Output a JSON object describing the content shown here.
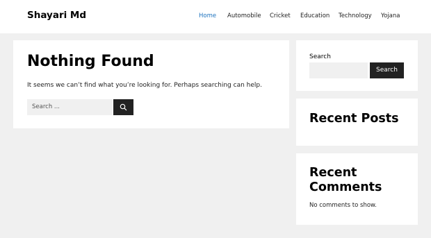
{
  "site": {
    "title": "Shayari Md"
  },
  "nav": {
    "items": [
      {
        "label": "Home",
        "active": true
      },
      {
        "label": "Automobile",
        "active": false
      },
      {
        "label": "Cricket",
        "active": false
      },
      {
        "label": "Education",
        "active": false
      },
      {
        "label": "Technology",
        "active": false
      },
      {
        "label": "Yojana",
        "active": false
      }
    ]
  },
  "main": {
    "title": "Nothing Found",
    "message": "It seems we can’t find what you’re looking for. Perhaps searching can help.",
    "search": {
      "placeholder": "Search ...",
      "button_icon": "search-icon"
    }
  },
  "sidebar": {
    "search_widget": {
      "label": "Search",
      "button_label": "Search"
    },
    "recent_posts": {
      "title": "Recent Posts"
    },
    "recent_comments": {
      "title": "Recent Comments",
      "empty_text": "No comments to show."
    }
  },
  "colors": {
    "accent": "#1e73be",
    "button": "#222222",
    "background": "#f0f0f0"
  }
}
